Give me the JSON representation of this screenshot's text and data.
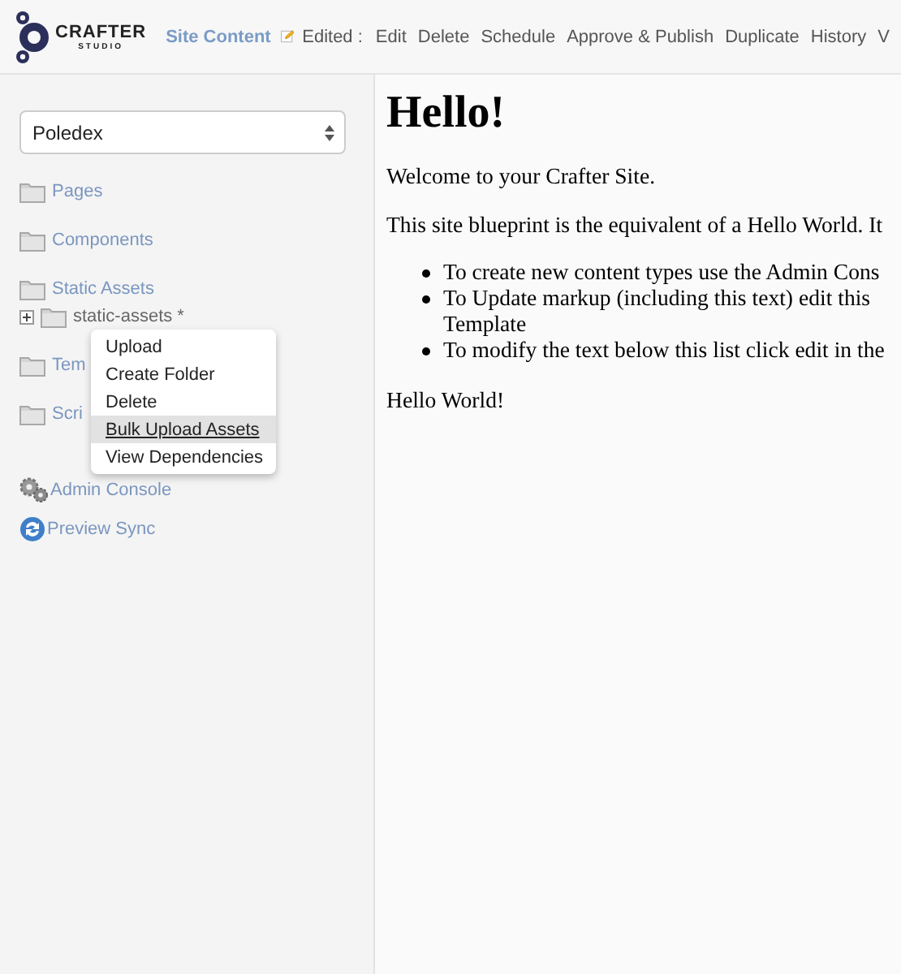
{
  "header": {
    "logo": {
      "name": "CRAFTER",
      "tagline": "STUDIO"
    },
    "site_content": "Site Content",
    "edited_label": "Edited :",
    "actions": [
      "Edit",
      "Delete",
      "Schedule",
      "Approve & Publish",
      "Duplicate",
      "History",
      "V"
    ]
  },
  "sidebar": {
    "site_select": {
      "value": "Poledex"
    },
    "tree": [
      {
        "label": "Pages"
      },
      {
        "label": "Components"
      },
      {
        "label": "Static Assets",
        "children": [
          {
            "label": "static-assets *",
            "expanded": false
          }
        ]
      },
      {
        "label": "Tem"
      },
      {
        "label": "Scri"
      }
    ],
    "tools": [
      {
        "label": "Admin Console",
        "kind": "gear"
      },
      {
        "label": "Preview Sync",
        "kind": "sync"
      }
    ]
  },
  "context_menu": {
    "items": [
      {
        "label": "Upload",
        "selected": false
      },
      {
        "label": "Create Folder",
        "selected": false
      },
      {
        "label": "Delete",
        "selected": false
      },
      {
        "label": "Bulk Upload Assets",
        "selected": true
      },
      {
        "label": "View Dependencies",
        "selected": false
      }
    ]
  },
  "page": {
    "heading": "Hello!",
    "paragraphs": [
      "Welcome to your Crafter Site.",
      "This site blueprint is the equivalent of a Hello World. It"
    ],
    "bullets": [
      {
        "lines": [
          "To create new content types use the Admin Cons"
        ]
      },
      {
        "lines": [
          "To Update markup (including this text) edit this",
          "Template"
        ]
      },
      {
        "lines": [
          "To modify the text below this list click edit in the"
        ]
      }
    ],
    "closing": "Hello World!"
  }
}
